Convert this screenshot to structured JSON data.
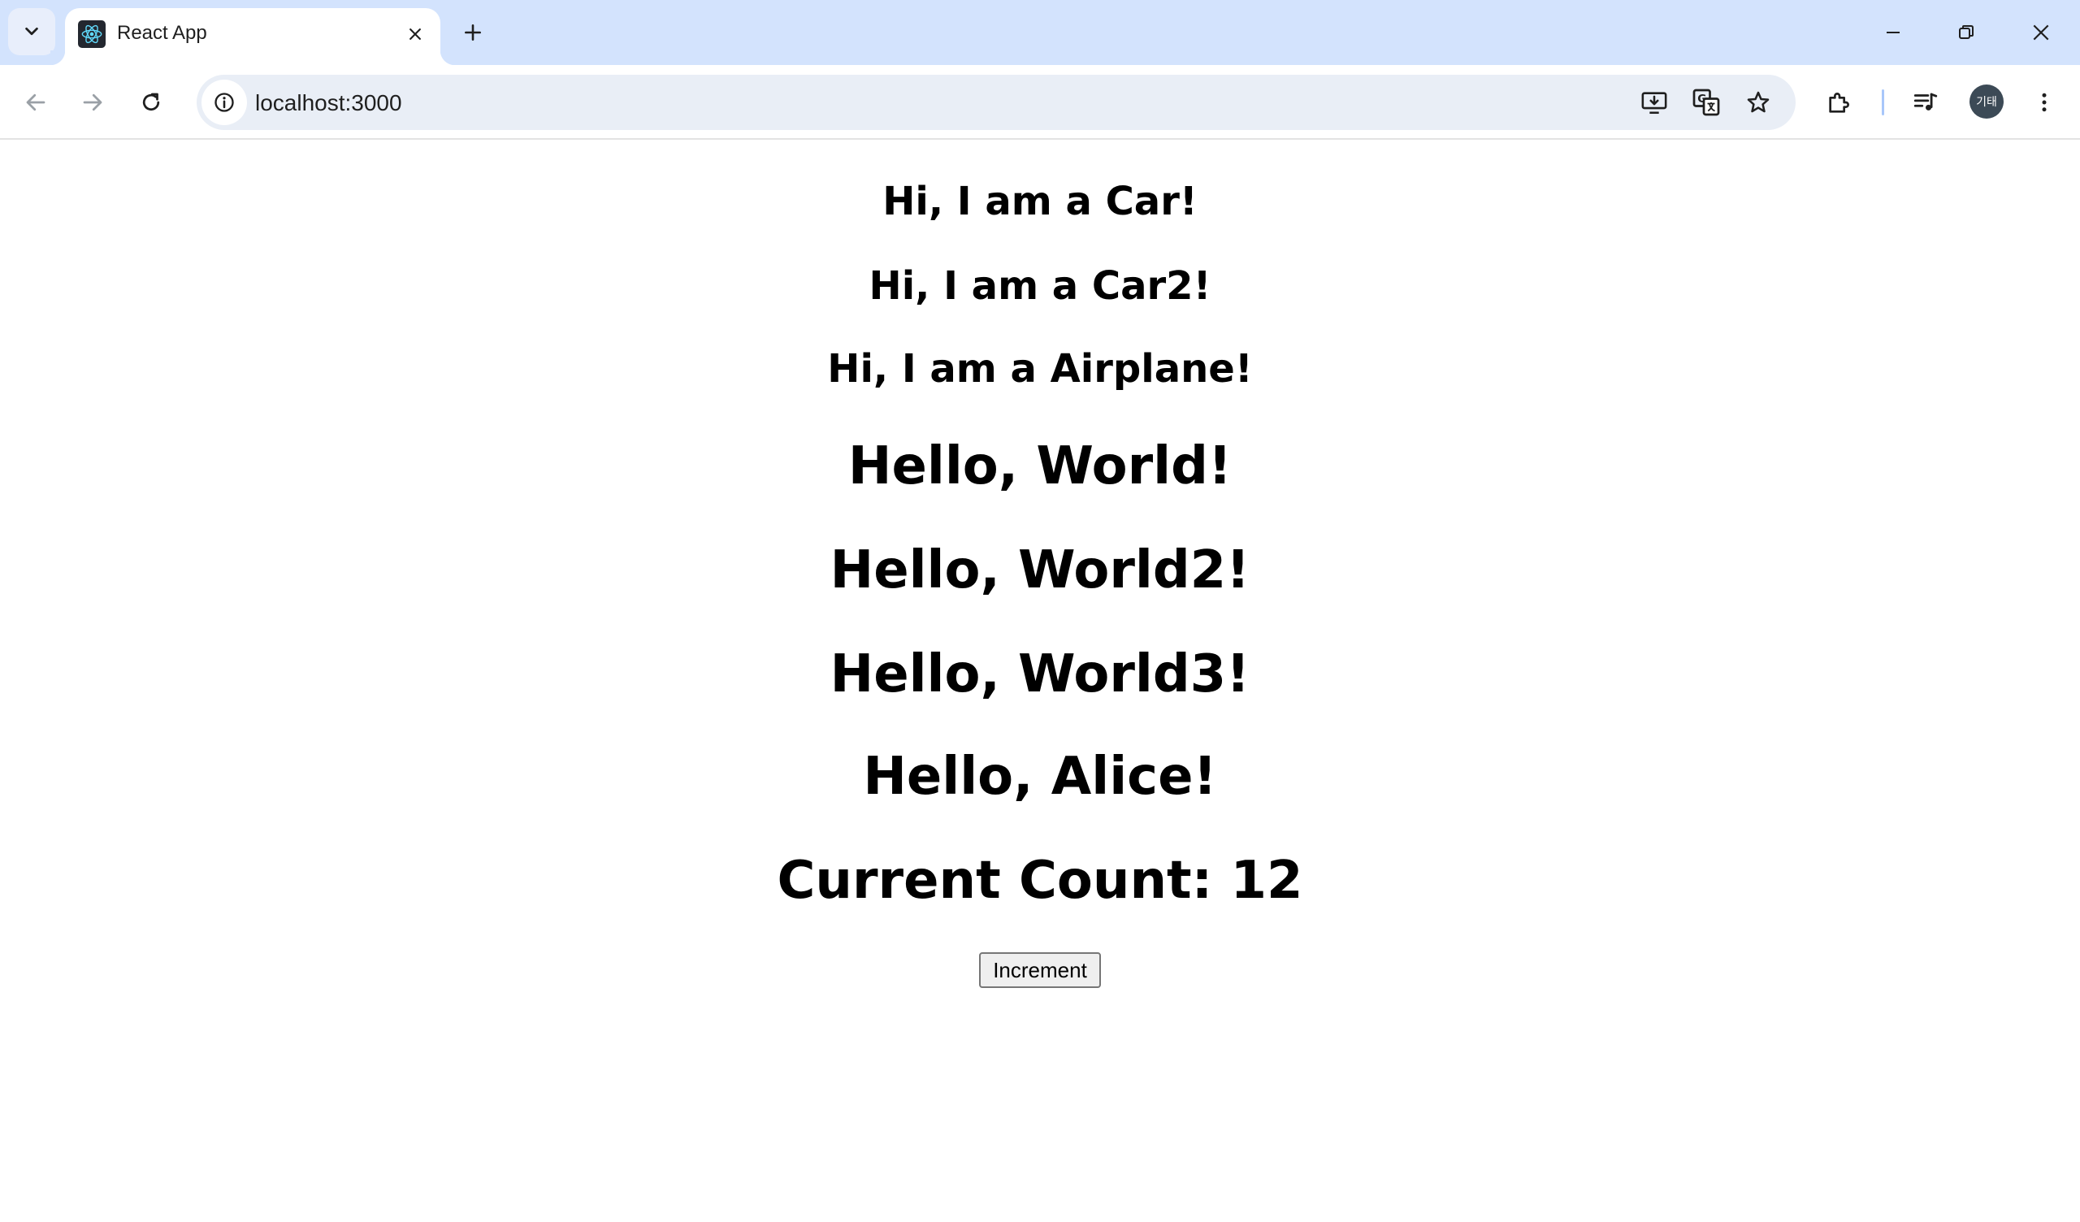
{
  "tab": {
    "title": "React App"
  },
  "toolbar": {
    "url": "localhost:3000",
    "profile_initials": "기태"
  },
  "page": {
    "headings_small": [
      "Hi, I am a Car!",
      "Hi, I am a Car2!",
      "Hi, I am a Airplane!"
    ],
    "headings_large": [
      "Hello, World!",
      "Hello, World2!",
      "Hello, World3!",
      "Hello, Alice!"
    ],
    "count_text": "Current Count: 12",
    "increment_label": "Increment"
  },
  "icons": {
    "tab_search": "chevron-down-icon",
    "favicon": "react-logo-icon",
    "tab_close": "close-icon",
    "new_tab": "plus-icon",
    "minimize": "minimize-icon",
    "restore": "restore-icon",
    "close_window": "close-icon",
    "back": "arrow-left-icon",
    "forward": "arrow-right-icon",
    "reload": "reload-icon",
    "site_info": "info-icon",
    "install_app": "install-icon",
    "translate": "translate-icon",
    "bookmark": "star-icon",
    "extensions": "puzzle-icon",
    "media": "media-control-icon",
    "menu": "kebab-menu-icon"
  },
  "colors": {
    "tabstrip_bg": "#d3e3fd",
    "omnibox_bg": "#e9eef6",
    "react_blue": "#61dafb",
    "avatar_bg": "#3c4a56"
  }
}
